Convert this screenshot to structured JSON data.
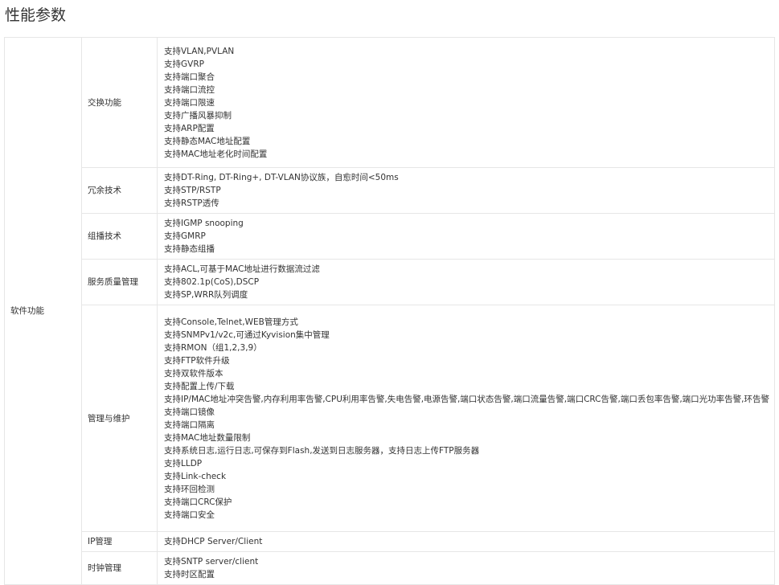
{
  "page": {
    "title": "性能参数"
  },
  "table": {
    "category": "软件功能",
    "rows": [
      {
        "label": "交换功能",
        "items": [
          "支持VLAN,PVLAN",
          "支持GVRP",
          "支持端口聚合",
          "支持端口流控",
          "支持端口限速",
          "支持广播风暴抑制",
          "支持ARP配置",
          "支持静态MAC地址配置",
          "支持MAC地址老化时间配置"
        ]
      },
      {
        "label": "冗余技术",
        "items": [
          "支持DT-Ring, DT-Ring+, DT-VLAN协议族，自愈时间<50ms",
          "支持STP/RSTP",
          "支持RSTP透传"
        ]
      },
      {
        "label": "组播技术",
        "items": [
          "支持IGMP snooping",
          "支持GMRP",
          "支持静态组播"
        ]
      },
      {
        "label": "服务质量管理",
        "items": [
          "支持ACL,可基于MAC地址进行数据流过滤",
          "支持802.1p(CoS),DSCP",
          "支持SP,WRR队列调度"
        ]
      },
      {
        "label": "管理与维护",
        "items": [
          "支持Console,Telnet,WEB管理方式",
          "支持SNMPv1/v2c,可通过Kyvision集中管理",
          "支持RMON（组1,2,3,9）",
          "支持FTP软件升级",
          "支持双软件版本",
          "支持配置上传/下载",
          "支持IP/MAC地址冲突告警,内存利用率告警,CPU利用率告警,失电告警,电源告警,端口状态告警,端口流量告警,端口CRC告警,端口丢包率告警,端口光功率告警,环告警",
          "支持端口镜像",
          "支持端口隔离",
          "支持MAC地址数量限制",
          "支持系统日志,运行日志,可保存到Flash,发送到日志服务器，支持日志上传FTP服务器",
          "支持LLDP",
          "支持Link-check",
          "支持环回检测",
          "支持端口CRC保护",
          "支持端口安全"
        ]
      },
      {
        "label": "IP管理",
        "items": [
          "支持DHCP Server/Client"
        ]
      },
      {
        "label": "时钟管理",
        "items": [
          "支持SNTP server/client",
          "支持时区配置"
        ]
      }
    ]
  }
}
